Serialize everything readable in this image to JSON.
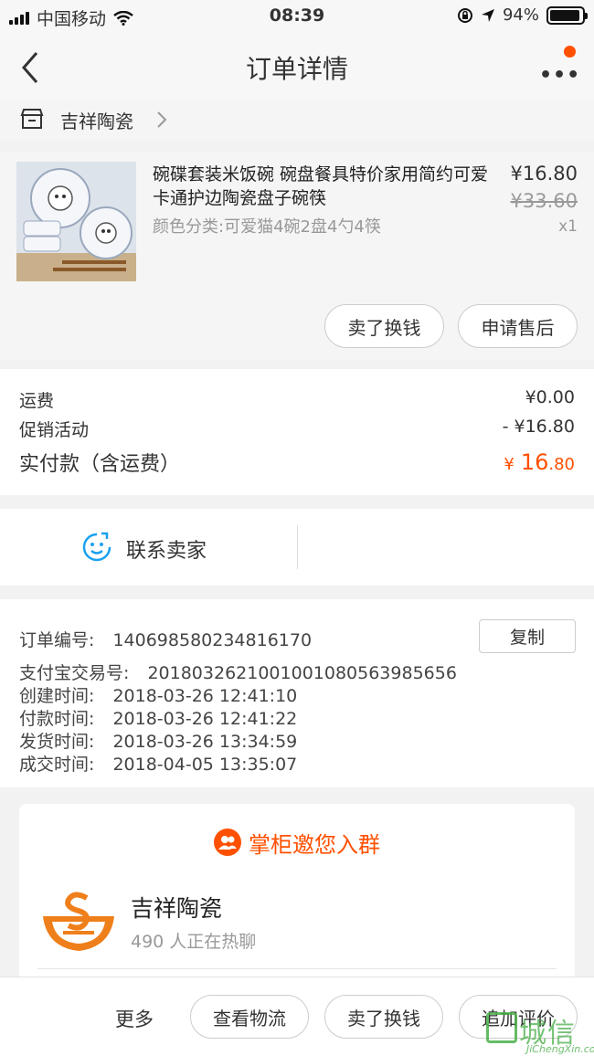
{
  "status": {
    "carrier": "中国移动",
    "time": "08:39",
    "battery": "94%",
    "battery_level": 0.94
  },
  "nav": {
    "title": "订单详情"
  },
  "shop": {
    "name": "吉祥陶瓷"
  },
  "item": {
    "name": "碗碟套装米饭碗 碗盘餐具特价家用简约可爱卡通护边陶瓷盘子碗筷",
    "spec": "颜色分类:可爱猫4碗2盘4勺4筷",
    "price": "¥16.80",
    "original_price": "¥33.60",
    "quantity": "x1",
    "sell_label": "卖了换钱",
    "aftersale_label": "申请售后"
  },
  "fees": {
    "shipping_label": "运费",
    "shipping_value": "¥0.00",
    "promo_label": "促销活动",
    "promo_value": "- ¥16.80",
    "paid_label": "实付款（含运费）",
    "paid_currency": "¥",
    "paid_int": "16",
    "paid_dec": ".80"
  },
  "contact": {
    "label": "联系卖家"
  },
  "order_info": {
    "order_no_label": "订单编号:",
    "order_no": "140698580234816170",
    "copy_label": "复制",
    "alipay_label": "支付宝交易号:",
    "alipay_no": "2018032621001001080563985656",
    "created_label": "创建时间:",
    "created": "2018-03-26 12:41:10",
    "paid_label": "付款时间:",
    "paid": "2018-03-26 12:41:22",
    "shipped_label": "发货时间:",
    "shipped": "2018-03-26 13:34:59",
    "completed_label": "成交时间:",
    "completed": "2018-04-05 13:35:07"
  },
  "group": {
    "header": "掌柜邀您入群",
    "name": "吉祥陶瓷",
    "count": "490 人正在热聊"
  },
  "bottom": {
    "more": "更多",
    "logistics": "查看物流",
    "sell": "卖了换钱",
    "review": "追加评价"
  },
  "watermark": {
    "text": "城信",
    "url": "JiChengXin.com"
  },
  "colors": {
    "accent": "#ff5000",
    "watermark": "#4ab04a"
  }
}
